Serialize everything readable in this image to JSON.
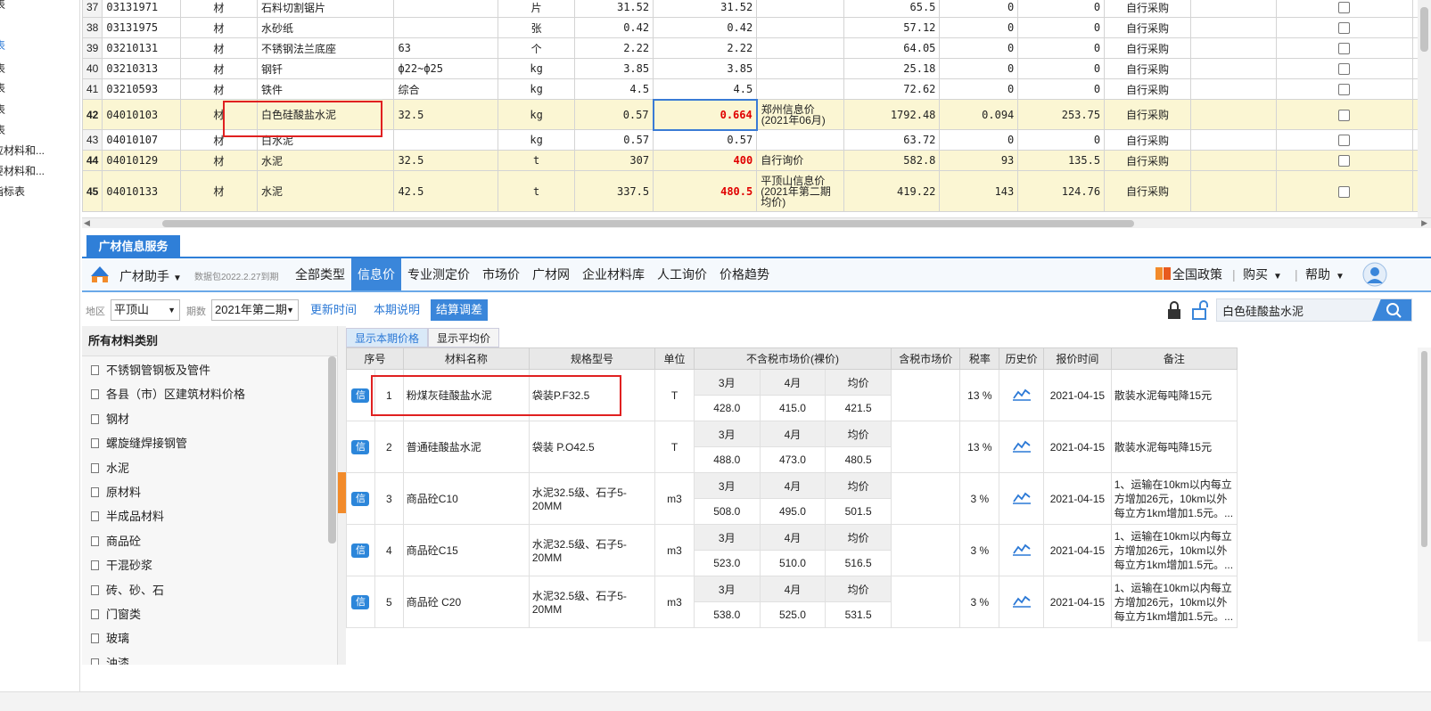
{
  "left_nav": [
    {
      "label": "表",
      "active": false
    },
    {
      "label": "表",
      "active": true
    },
    {
      "label": "表",
      "active": false
    },
    {
      "label": "表",
      "active": false
    },
    {
      "label": "表",
      "active": false
    },
    {
      "label": "表",
      "active": false
    },
    {
      "label": "应材料和...",
      "active": false
    },
    {
      "label": "要材料和...",
      "active": false
    },
    {
      "label": "指标表",
      "active": false
    }
  ],
  "top_grid": {
    "rows": [
      {
        "no": "37",
        "code": "03131971",
        "type": "材",
        "name": "石料切割锯片",
        "spec": "",
        "unit": "片",
        "price1": "31.52",
        "price2": "31.52",
        "price2_red": false,
        "source": "",
        "qty": "65.5",
        "v1": "0",
        "v2": "0",
        "supply": "自行采购",
        "highlight": false
      },
      {
        "no": "38",
        "code": "03131975",
        "type": "材",
        "name": "水砂纸",
        "spec": "",
        "unit": "张",
        "price1": "0.42",
        "price2": "0.42",
        "price2_red": false,
        "source": "",
        "qty": "57.12",
        "v1": "0",
        "v2": "0",
        "supply": "自行采购",
        "highlight": false
      },
      {
        "no": "39",
        "code": "03210131",
        "type": "材",
        "name": "不锈钢法兰底座",
        "spec": "63",
        "unit": "个",
        "price1": "2.22",
        "price2": "2.22",
        "price2_red": false,
        "source": "",
        "qty": "64.05",
        "v1": "0",
        "v2": "0",
        "supply": "自行采购",
        "highlight": false
      },
      {
        "no": "40",
        "code": "03210313",
        "type": "材",
        "name": "钢钎",
        "spec": "ф22~ф25",
        "unit": "kg",
        "price1": "3.85",
        "price2": "3.85",
        "price2_red": false,
        "source": "",
        "qty": "25.18",
        "v1": "0",
        "v2": "0",
        "supply": "自行采购",
        "highlight": false
      },
      {
        "no": "41",
        "code": "03210593",
        "type": "材",
        "name": "铁件",
        "spec": "综合",
        "unit": "kg",
        "price1": "4.5",
        "price2": "4.5",
        "price2_red": false,
        "source": "",
        "qty": "72.62",
        "v1": "0",
        "v2": "0",
        "supply": "自行采购",
        "highlight": false
      },
      {
        "no": "42",
        "code": "04010103",
        "type": "材",
        "name": "白色硅酸盐水泥",
        "spec": "32.5",
        "unit": "kg",
        "price1": "0.57",
        "price2": "0.664",
        "price2_red": true,
        "source": "郑州信息价(2021年06月)",
        "qty": "1792.48",
        "v1": "0.094",
        "v2": "253.75",
        "supply": "自行采购",
        "highlight": true
      },
      {
        "no": "43",
        "code": "04010107",
        "type": "材",
        "name": "白水泥",
        "spec": "",
        "unit": "kg",
        "price1": "0.57",
        "price2": "0.57",
        "price2_red": false,
        "source": "",
        "qty": "63.72",
        "v1": "0",
        "v2": "0",
        "supply": "自行采购",
        "highlight": false
      },
      {
        "no": "44",
        "code": "04010129",
        "type": "材",
        "name": "水泥",
        "spec": "32.5",
        "unit": "t",
        "price1": "307",
        "price2": "400",
        "price2_red": true,
        "source": "自行询价",
        "qty": "582.8",
        "v1": "93",
        "v2": "135.5",
        "supply": "自行采购",
        "highlight": true
      },
      {
        "no": "45",
        "code": "04010133",
        "type": "材",
        "name": "水泥",
        "spec": "42.5",
        "unit": "t",
        "price1": "337.5",
        "price2": "480.5",
        "price2_red": true,
        "source": "平顶山信息价(2021年第二期均价)",
        "qty": "419.22",
        "v1": "143",
        "v2": "124.76",
        "supply": "自行采购",
        "highlight": true
      }
    ]
  },
  "panel": {
    "tab_label": "广材信息服务",
    "brand": "广材助手",
    "package_note": "数据包2022.2.27到期",
    "tabs": [
      {
        "label": "全部类型",
        "active": false
      },
      {
        "label": "信息价",
        "active": true
      },
      {
        "label": "专业测定价",
        "active": false
      },
      {
        "label": "市场价",
        "active": false
      },
      {
        "label": "广材网",
        "active": false
      },
      {
        "label": "企业材料库",
        "active": false
      },
      {
        "label": "人工询价",
        "active": false
      },
      {
        "label": "价格趋势",
        "active": false
      }
    ],
    "policy": "全国政策",
    "buy": "购买",
    "help": "帮助"
  },
  "filters": {
    "region_label": "地区",
    "region_value": "平顶山",
    "period_label": "期数",
    "period_value": "2021年第二期",
    "update_time": "更新时间",
    "period_note": "本期说明",
    "settle_adjust": "结算调差",
    "search_value": "白色硅酸盐水泥"
  },
  "categories": {
    "title": "所有材料类别",
    "items": [
      "不锈钢管钢板及管件",
      "各县（市）区建筑材料价格",
      "钢材",
      "螺旋缝焊接钢管",
      "水泥",
      "原材料",
      "半成品材料",
      "商品砼",
      "干混砂浆",
      "砖、砂、石",
      "门窗类",
      "玻璃",
      "油漆"
    ]
  },
  "price_table": {
    "subtabs": [
      {
        "label": "显示本期价格",
        "active": true
      },
      {
        "label": "显示平均价",
        "active": false
      }
    ],
    "headers": {
      "no": "序号",
      "name": "材料名称",
      "spec": "规格型号",
      "unit": "单位",
      "price_excl": "不含税市场价(裸价)",
      "price_incl": "含税市场价",
      "tax": "税率",
      "history": "历史价",
      "quote_time": "报价时间",
      "note": "备注"
    },
    "month_headers": [
      "3月",
      "4月",
      "均价"
    ],
    "badge": "信",
    "rows": [
      {
        "no": "1",
        "name": "粉煤灰硅酸盐水泥",
        "spec": "袋装P.F32.5",
        "unit": "T",
        "m3": "428.0",
        "m4": "415.0",
        "avg": "421.5",
        "tax": "13 %",
        "date": "2021-04-15",
        "note": "散装水泥每吨降15元"
      },
      {
        "no": "2",
        "name": "普通硅酸盐水泥",
        "spec": "袋装 P.O42.5",
        "unit": "T",
        "m3": "488.0",
        "m4": "473.0",
        "avg": "480.5",
        "tax": "13 %",
        "date": "2021-04-15",
        "note": "散装水泥每吨降15元"
      },
      {
        "no": "3",
        "name": "商品砼C10",
        "spec": "水泥32.5级、石子5-20MM",
        "unit": "m3",
        "m3": "508.0",
        "m4": "495.0",
        "avg": "501.5",
        "tax": "3 %",
        "date": "2021-04-15",
        "note": "1、运输在10km以内每立方增加26元，10km以外每立方1km增加1.5元。..."
      },
      {
        "no": "4",
        "name": "商品砼C15",
        "spec": "水泥32.5级、石子5-20MM",
        "unit": "m3",
        "m3": "523.0",
        "m4": "510.0",
        "avg": "516.5",
        "tax": "3 %",
        "date": "2021-04-15",
        "note": "1、运输在10km以内每立方增加26元，10km以外每立方1km增加1.5元。..."
      },
      {
        "no": "5",
        "name": "商品砼 C20",
        "spec": "水泥32.5级、石子5-20MM",
        "unit": "m3",
        "m3": "538.0",
        "m4": "525.0",
        "avg": "531.5",
        "tax": "3 %",
        "date": "2021-04-15",
        "note": "1、运输在10km以内每立方增加26元，10km以外每立方1km增加1.5元。..."
      }
    ]
  },
  "colors": {
    "accent": "#2f7fd8",
    "highlight_row": "#fbf6d3",
    "red_value": "#e00000",
    "annotation_box": "#e02020"
  }
}
